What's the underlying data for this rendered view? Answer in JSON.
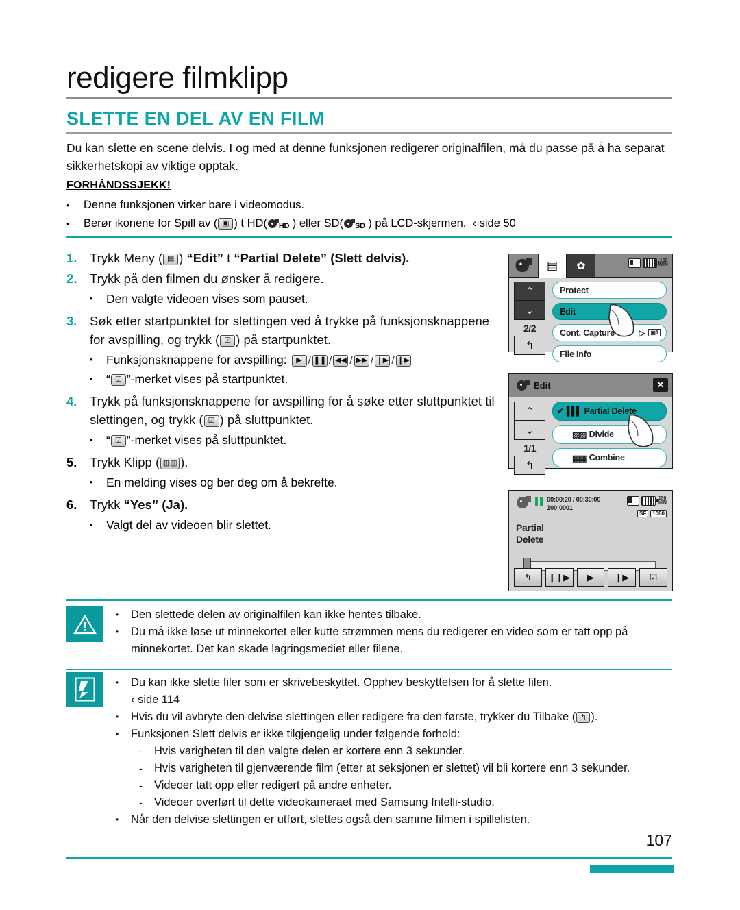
{
  "header": {
    "chapter_title": "redigere filmklipp",
    "section_title": "SLETTE EN DEL AV EN FILM",
    "intro": "Du kan slette en scene delvis.  I og med at denne funksjonen redigerer originalfilen, må du passe på å ha separat sikkerhetskopi av viktige opptak."
  },
  "precheck": {
    "title": "FORHÅNDSSJEKK!",
    "items": [
      "Denne funksjonen virker bare i videomodus.",
      "Berør ikonene for Spill av ("
    ],
    "item2_mid": ") t  HD(",
    "item2_hd": "HD",
    "item2_mid2": " ) eller SD(",
    "item2_sd": "SD",
    "item2_end": " ) på LCD-skjermen.",
    "item2_ref": "‹ side 50"
  },
  "steps": [
    {
      "num": "1.",
      "text_a": "Trykk Meny (",
      "text_b": ") ",
      "bold1": "“Edit”",
      "arrow": " t ",
      "bold2": "“Partial Delete” (Slett delvis)",
      "text_end": "."
    },
    {
      "num": "2.",
      "text": "Trykk på den filmen du ønsker å redigere.",
      "subs": [
        "Den valgte videoen vises som pauset."
      ]
    },
    {
      "num": "3.",
      "text_a": "Søk etter startpunktet for slettingen ved å trykke på funksjonsknappene for avspilling, og trykk (",
      "text_b": ") på startpunktet.",
      "sub_play_label": "Funksjonsknappene for avspilling:",
      "sub_mark_a": "“",
      "sub_mark_b": "”-merket vises på startpunktet."
    },
    {
      "num": "4.",
      "text_a": "Trykk på funksjonsknappene for avspilling for å søke etter sluttpunktet til slettingen, og trykk (",
      "text_b": ") på sluttpunktet.",
      "sub_mark_a": "“",
      "sub_mark_b": "”-merket vises på sluttpunktet."
    },
    {
      "num": "5.",
      "text_a": "Trykk Klipp (",
      "text_b": ").",
      "subs": [
        "En melding vises og ber deg om å bekrefte."
      ]
    },
    {
      "num": "6.",
      "text_a": "Trykk ",
      "bold1": "“Yes” (Ja)",
      "text_b": ".",
      "subs": [
        "Valgt del av videoen blir slettet."
      ]
    }
  ],
  "playback_icons": [
    "▶",
    "❙❙",
    "◀◀",
    "▶▶",
    "❙▶",
    "❙▶"
  ],
  "screens": {
    "menu_screen": {
      "page_indicator": "2/2",
      "status": {
        "minutes": "150",
        "min_label": "MIN"
      },
      "items": [
        {
          "label": "Protect",
          "selected": false
        },
        {
          "label": "Edit",
          "selected": true
        },
        {
          "label": "Cont. Capture",
          "selected": false,
          "right": "▷"
        },
        {
          "label": "File Info",
          "selected": false
        }
      ]
    },
    "edit_screen": {
      "title": "Edit",
      "page_indicator": "1/1",
      "items": [
        {
          "label": "Partial Delete",
          "selected": true,
          "check": "✔"
        },
        {
          "label": "Divide",
          "selected": false
        },
        {
          "label": "Combine",
          "selected": false
        }
      ]
    },
    "playback_screen": {
      "timecode": "00:00:20 / 00:30:00",
      "filenumber": "100-0001",
      "mode_label_line1": "Partial",
      "mode_label_line2": "Delete",
      "status": {
        "minutes": "150",
        "min_label": "MIN",
        "quality": "SF",
        "resolution": "1080"
      },
      "buttons": [
        "↰",
        "❙❙▶",
        "▶",
        "❙▶",
        "☑"
      ]
    }
  },
  "caution": {
    "icon": "warning-triangle",
    "items": [
      "Den slettede delen av originalfilen kan ikke hentes tilbake.",
      "Du må ikke løse ut minnekortet eller kutte strømmen mens du redigerer en video som er tatt opp på minnekortet. Det kan skade lagringsmediet eller filene."
    ]
  },
  "note": {
    "icon": "note-hand",
    "items": [
      {
        "text": "Du kan ikke slette filer som er skrivebeskyttet. Opphev beskyttelsen for å slette filen.",
        "ref": "‹ side 114"
      },
      {
        "text_a": "Hvis du vil avbryte den delvise slettingen eller redigere fra den første, trykker du Tilbake (",
        "text_b": ")."
      },
      {
        "text": "Funksjonen Slett delvis er ikke tilgjengelig under følgende forhold:",
        "subs": [
          "Hvis varigheten til den valgte delen er kortere enn 3 sekunder.",
          "Hvis varigheten til gjenværende film (etter at seksjonen er slettet) vil bli kortere enn 3 sekunder.",
          "Videoer tatt opp eller redigert på andre enheter.",
          "Videoer overført til dette videokameraet med Samsung Intelli-studio."
        ]
      },
      {
        "text": "Når den delvise slettingen er utført, slettes også den samme filmen i spillelisten."
      }
    ]
  },
  "footer": {
    "page_number": "107"
  },
  "colors": {
    "accent_teal": "#0ea5a7",
    "lcd_selected": "#10a5a6",
    "green_pause": "#18a85a"
  }
}
